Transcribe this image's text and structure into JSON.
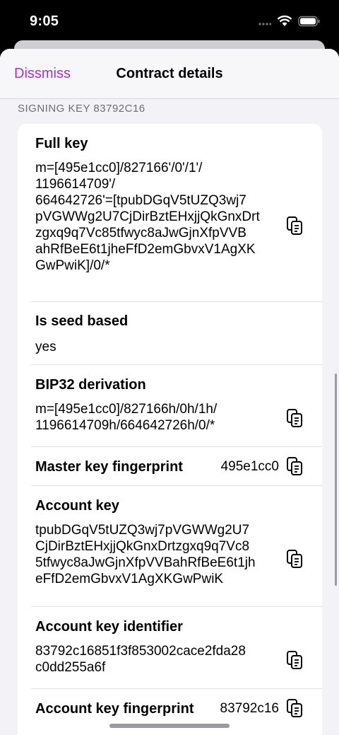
{
  "status": {
    "time": "9:05"
  },
  "nav": {
    "dismiss": "Dissmiss",
    "title": "Contract details"
  },
  "section": {
    "header": "SIGNING KEY 83792C16"
  },
  "rows": {
    "full_key": {
      "label": "Full key",
      "value": "m=[495e1cc0]/827166'/0'/1'/\n1196614709'/\n664642726'=[tpubDGqV5tUZQ3wj7\npVGWWg2U7CjDirBztEHxjjQkGnxDrt\nzgxq9q7Vc85tfwyc8aJwGjnXfpVVB\nahRfBeE6t1jheFfD2emGbvxV1AgXK\nGwPwiK]/0/*"
    },
    "seed_based": {
      "label": "Is seed based",
      "value": "yes"
    },
    "bip32": {
      "label": "BIP32 derivation",
      "value": "m=[495e1cc0]/827166h/0h/1h/\n1196614709h/664642726h/0/*"
    },
    "master_fp": {
      "label": "Master key fingerprint",
      "value": "495e1cc0"
    },
    "account_key": {
      "label": "Account key",
      "value": "tpubDGqV5tUZQ3wj7pVGWWg2U7\nCjDirBztEHxjjQkGnxDrtzgxq9q7Vc8\n5tfwyc8aJwGjnXfpVVBahRfBeE6t1jh\neFfD2emGbvxV1AgXKGwPwiK"
    },
    "account_id": {
      "label": "Account key identifier",
      "value": "83792c16851f3f853002cace2fda28\nc0dd255a6f"
    },
    "account_fp": {
      "label": "Account key fingerprint",
      "value": "83792c16"
    }
  },
  "colors": {
    "accent": "#a62fd6",
    "background": "#f2f2f7",
    "card": "#ffffff"
  },
  "icons": {
    "copy": "copy-icon",
    "wifi": "wifi-icon",
    "battery": "battery-icon",
    "signal": "signal-icon"
  }
}
